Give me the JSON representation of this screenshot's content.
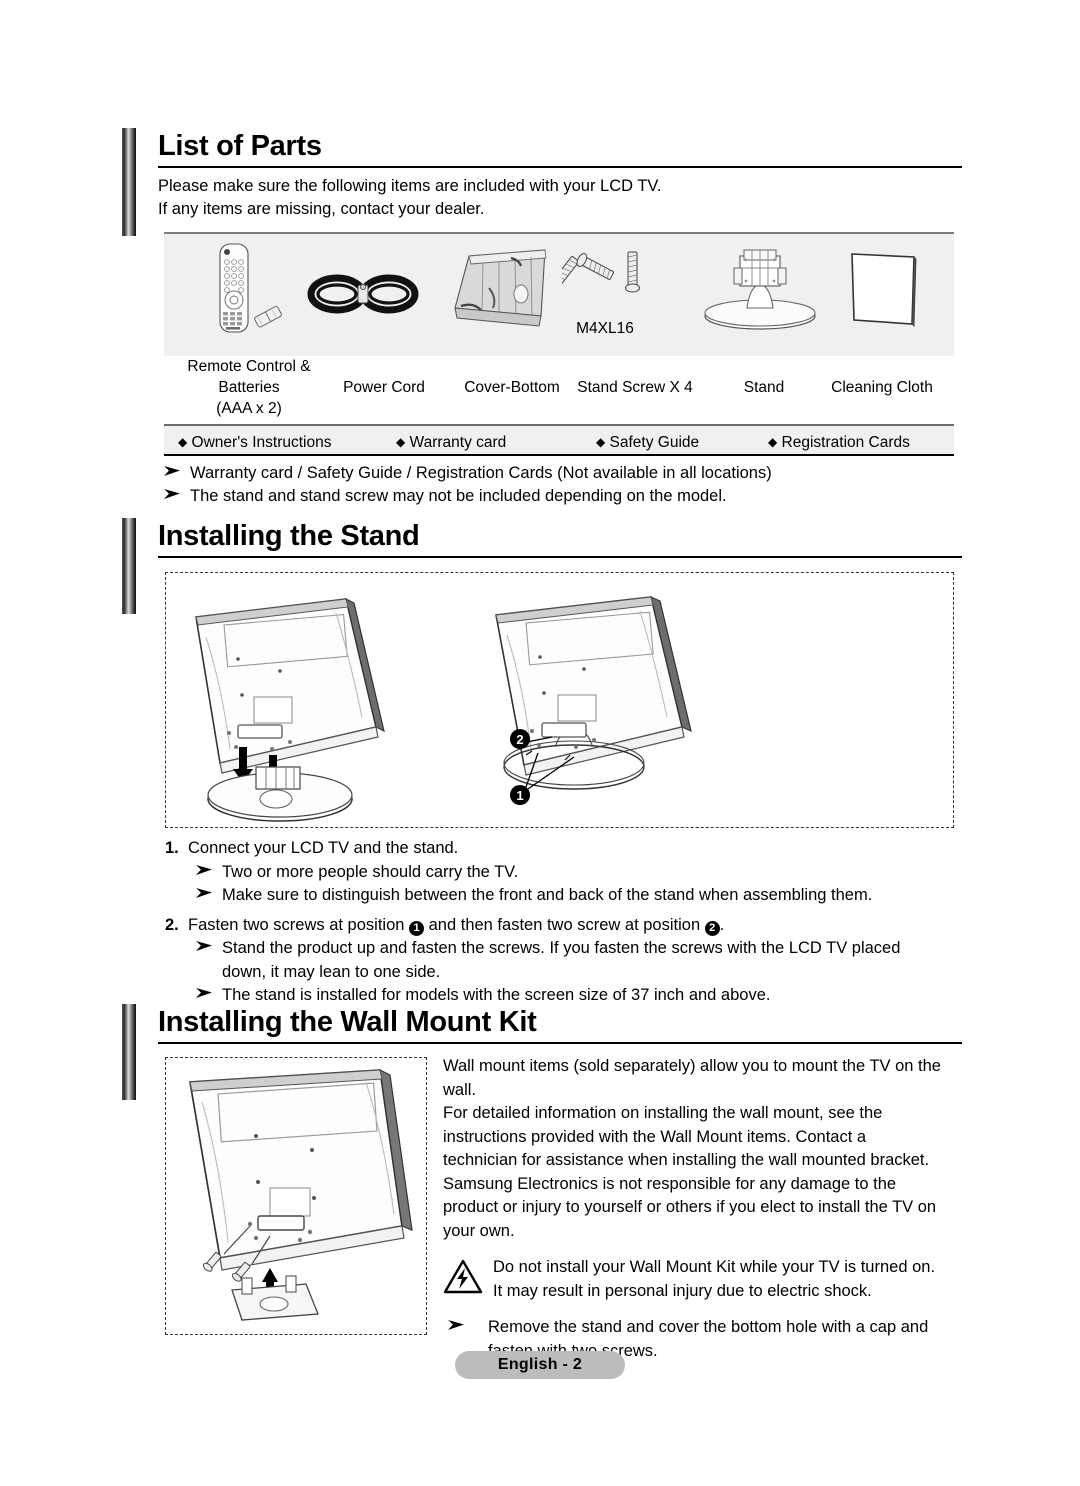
{
  "sections": {
    "list_of_parts": {
      "heading": "List of Parts",
      "intro_line1": "Please make sure the following items are included with your LCD TV.",
      "intro_line2": "If any items are missing, contact your dealer."
    },
    "installing_stand": {
      "heading": "Installing the Stand"
    },
    "wall_mount": {
      "heading": "Installing the Wall Mount Kit"
    }
  },
  "parts_table": {
    "items": [
      {
        "icon": "remote-control-icon",
        "label_line1": "Remote Control &",
        "label_line2": "Batteries",
        "label_line3": "(AAA x 2)"
      },
      {
        "icon": "power-cord-icon",
        "label_line1": "Power Cord",
        "label_line2": "",
        "label_line3": ""
      },
      {
        "icon": "cover-bottom-icon",
        "label_line1": "Cover-Bottom",
        "label_line2": "",
        "label_line3": ""
      },
      {
        "icon": "stand-screw-icon",
        "label_line1": "Stand Screw X 4",
        "label_line2": "",
        "label_line3": "",
        "caption": "M4XL16"
      },
      {
        "icon": "stand-icon",
        "label_line1": "Stand",
        "label_line2": "",
        "label_line3": ""
      },
      {
        "icon": "cleaning-cloth-icon",
        "label_line1": "Cleaning Cloth",
        "label_line2": "",
        "label_line3": ""
      }
    ],
    "extras": [
      "Owner's Instructions",
      "Warranty card",
      "Safety Guide",
      "Registration Cards"
    ],
    "extras_bullet": "•"
  },
  "parts_notes": [
    "Warranty card / Safety Guide / Registration Cards (Not available in all locations)",
    "The stand and stand screw may not be included depending on the model."
  ],
  "stand_steps": {
    "step1_num": "1.",
    "step1_text": "Connect your LCD TV and the stand.",
    "step1_subs": [
      "Two or more people should carry the TV.",
      "Make sure to distinguish between the front and back of the stand when assembling them."
    ],
    "step2_num": "2.",
    "step2_prefix": "Fasten two screws at position",
    "step2_mid": "and then fasten two screw at position",
    "step2_suffix": ".",
    "step2_marker_a": "1",
    "step2_marker_b": "2",
    "step2_sub1_line1": "Stand the product up and fasten the screws. If you fasten the screws with the LCD TV placed",
    "step2_sub1_line2": "down, it may lean to one side.",
    "step2_sub2": "The stand is installed for models with the screen size of 37 inch and above."
  },
  "stand_diagram": {
    "marker_1": "1",
    "marker_2": "2"
  },
  "wall_mount_text": {
    "para1": "Wall mount items (sold separately) allow you to mount the TV on the wall.",
    "para2": "For detailed information on installing the wall mount, see the instructions provided with the Wall Mount items. Contact a technician for assistance when installing the wall mounted bracket. Samsung Electronics is not responsible for any damage to the product or injury to yourself or others if you elect to install the TV on your own.",
    "warning": "Do not install your Wall Mount Kit while your TV is turned on. It may result in personal injury due to electric shock.",
    "note": "Remove the stand and cover the bottom hole with a cap and fasten with two screws."
  },
  "footer": {
    "label": "English - 2"
  },
  "colors": {
    "table_bg": "#f0f0f0",
    "footer_bg": "#bcbcbc",
    "rule": "#000000"
  }
}
